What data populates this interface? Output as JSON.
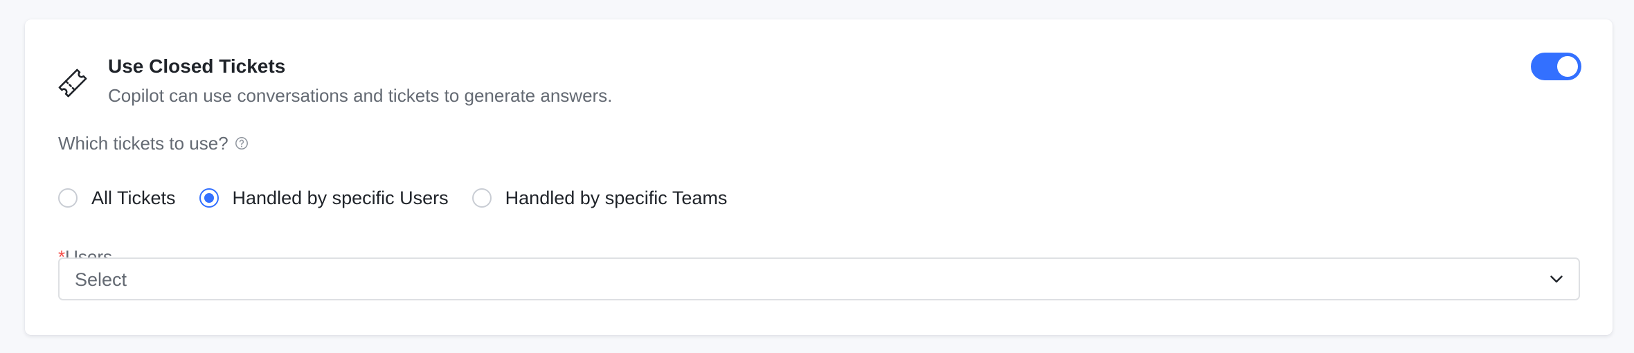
{
  "setting": {
    "icon": "ticket-icon",
    "title": "Use Closed Tickets",
    "description": "Copilot can use conversations and tickets to generate answers.",
    "enabled": true
  },
  "ticket_selection": {
    "question": "Which tickets to use?",
    "help_icon": "question-circle-icon",
    "options": [
      {
        "label": "All Tickets",
        "selected": false
      },
      {
        "label": "Handled by specific Users",
        "selected": true
      },
      {
        "label": "Handled by specific Teams",
        "selected": false
      }
    ]
  },
  "users_field": {
    "required_mark": "*",
    "label": "Users",
    "placeholder": "Select",
    "dropdown_icon": "chevron-down-icon"
  },
  "colors": {
    "accent": "#3370ff",
    "required": "#f54a45",
    "muted_text": "#646a73",
    "border": "#dee0e3"
  }
}
